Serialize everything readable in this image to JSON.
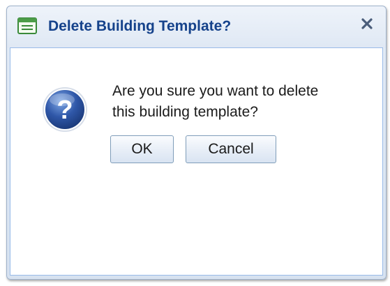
{
  "dialog": {
    "title": "Delete Building Template?",
    "close_glyph": "x",
    "message_line1": "Are you sure you want to delete",
    "message_line2": "this building template?",
    "ok_label": "OK",
    "cancel_label": "Cancel",
    "title_icon": "window-form-icon",
    "message_icon": "question-icon"
  },
  "colors": {
    "title_text": "#15428b",
    "icon_blue": "#2f57a8",
    "icon_green": "#3a8a3a"
  }
}
